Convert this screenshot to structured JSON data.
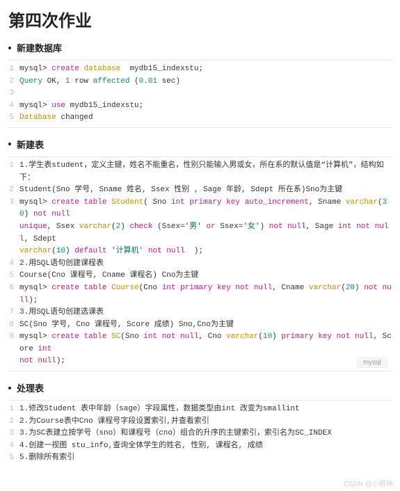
{
  "title": "第四次作业",
  "sections": [
    {
      "heading": "新建数据库"
    },
    {
      "heading": "新建表"
    },
    {
      "heading": "处理表"
    }
  ],
  "block1": {
    "l1": {
      "prompt": "mysql> ",
      "kw1": "create",
      "fn": "database",
      "rest": "  mydb15_indexstu;"
    },
    "l2": {
      "a": "Query",
      "b": " OK, ",
      "c": "1",
      "d": " row ",
      "e": "affected",
      "f": " (",
      "g": "0.01",
      "h": " sec)"
    },
    "l3": "",
    "l4": {
      "prompt": "mysql> ",
      "kw": "use",
      "rest": " mydb15_indexstu;"
    },
    "l5": {
      "a": "Database",
      "b": " changed"
    }
  },
  "block2": {
    "l1": "1.学生表student，定义主键，姓名不能重名，性别只能输入男或女，所在系的默认值是“计算机”，结构如下：",
    "l2": "Student(Sno 学号, Sname 姓名, Ssex 性别 , Sage 年龄, Sdept 所在系)Sno为主键",
    "l3_a": "mysql> ",
    "l3_b": "create",
    "l3_c": "table",
    "l3_d": "Student",
    "l3_e": "( Sno ",
    "l3_f": "int",
    "l3_g": "primary",
    "l3_h": "key",
    "l3_i": "auto_increment",
    "l3_j": ", Sname ",
    "l3_k": "varchar",
    "l3_l": "(",
    "l3_m": "30",
    "l3_n": ") ",
    "l3_o": "not",
    "l3_p": "null",
    "l4_a": "unique",
    "l4_b": ", Ssex ",
    "l4_c": "varchar",
    "l4_d": "(",
    "l4_e": "2",
    "l4_f": ") ",
    "l4_g": "check",
    "l4_h": " (Ssex=",
    "l4_i": "'男'",
    "l4_j": "or",
    "l4_k": " Ssex=",
    "l4_l": "'女'",
    "l4_m": ") ",
    "l4_n": "not",
    "l4_o": "null",
    "l4_p": ", Sage ",
    "l4_q": "int",
    "l4_r": "not",
    "l4_s": "null",
    "l4_t": ", Sdept",
    "l5_a": "varchar",
    "l5_b": "(",
    "l5_c": "10",
    "l5_d": ") ",
    "l5_e": "default",
    "l5_f": "'计算机'",
    "l5_g": "not",
    "l5_h": "null",
    "l5_i": "  );",
    "l6": "2.用SQL语句创建课程表",
    "l7": "Course(Cno 课程号, Cname 课程名) Cno为主键",
    "l8_a": "mysql> ",
    "l8_b": "create",
    "l8_c": "table",
    "l8_d": "Course",
    "l8_e": "(Cno ",
    "l8_f": "int",
    "l8_g": "primary",
    "l8_h": "key",
    "l8_i": "not",
    "l8_j": "null",
    "l8_k": ", Cname ",
    "l8_l": "varchar",
    "l8_m": "(",
    "l8_n": "20",
    "l8_o": ") ",
    "l8_p": "not",
    "l8_q": "null",
    "l8_r": ");",
    "l9": "3.用SQL语句创建选课表",
    "l10": "SC(Sno 学号, Cno 课程号, Score 成绩) Sno,Cno为主键",
    "l11_a": "mysql> ",
    "l11_b": "create",
    "l11_c": "table",
    "l11_d": "SC",
    "l11_e": "(Sno ",
    "l11_f": "int",
    "l11_g": "not",
    "l11_h": "null",
    "l11_i": ", Cno ",
    "l11_j": "varchar",
    "l11_k": "(",
    "l11_l": "10",
    "l11_m": ") ",
    "l11_n": "primary",
    "l11_o": "key",
    "l11_p": "not",
    "l11_q": "null",
    "l11_r": ", Score ",
    "l11_s": "int",
    "l12_a": "not",
    "l12_b": "null",
    "l12_c": ");",
    "lang": "mysql"
  },
  "block3": {
    "l1": "1.修改Student 表中年龄（sage）字段属性，数据类型由int 改变为smallint",
    "l2": "2.为Course表中Cno 课程号字段设置索引,并查看索引",
    "l3": "3.为SC表建立按学号（sno）和课程号（cno）组合的升序的主键索引，索引名为SC_INDEX",
    "l4": "4.创建一视图 stu_info,查询全体学生的姓名, 性别, 课程名, 成绩",
    "l5": "5.删除所有索引"
  },
  "watermark": "CSDN @小眼神"
}
